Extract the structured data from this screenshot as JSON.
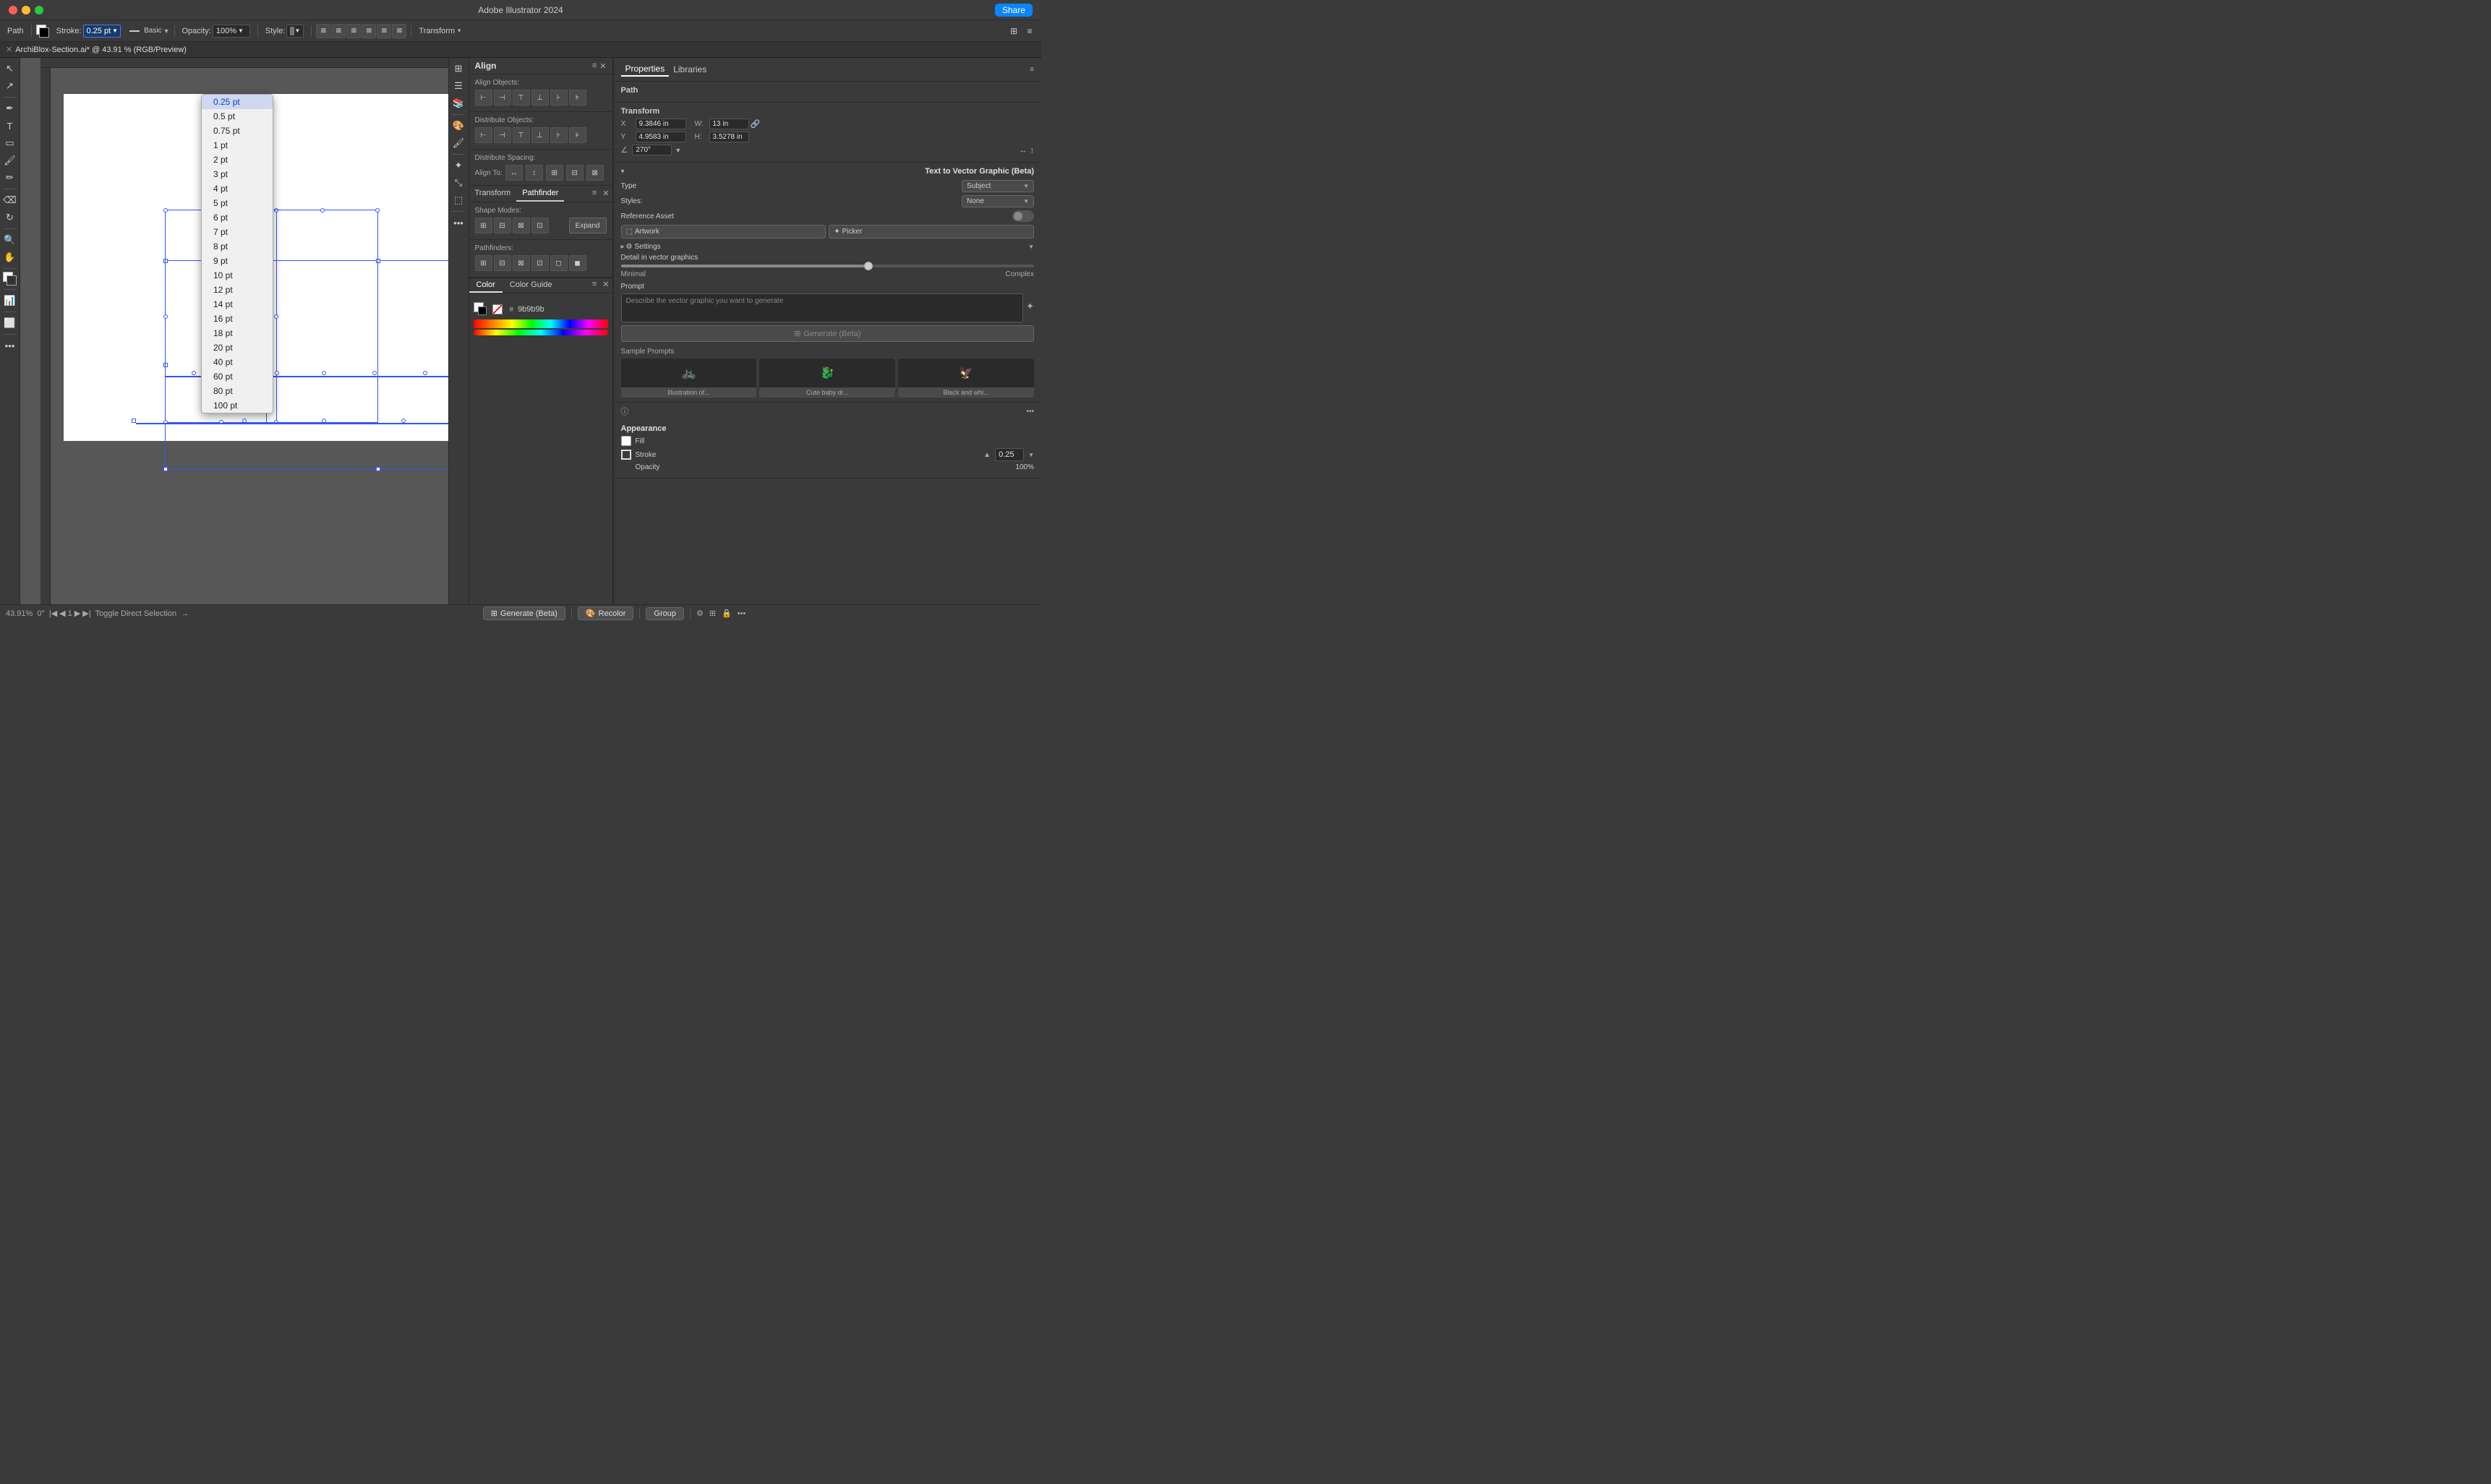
{
  "app": {
    "title": "Adobe Illustrator 2024",
    "share_label": "Share",
    "tab_label": "ArchiBlox-Section.ai* @ 43.91 % (RGB/Preview)"
  },
  "toolbar": {
    "type_label": "Path",
    "stroke_label": "Stroke:",
    "stroke_value": "0.25 pt",
    "opacity_label": "Opacity:",
    "opacity_value": "100%",
    "style_label": "Style:",
    "basic_label": "Basic",
    "transform_label": "Transform"
  },
  "stroke_dropdown": {
    "items": [
      {
        "value": "0.25 pt",
        "selected": true
      },
      {
        "value": "0.5 pt",
        "selected": false
      },
      {
        "value": "0.75 pt",
        "selected": false
      },
      {
        "value": "1 pt",
        "selected": false
      },
      {
        "value": "2 pt",
        "selected": false
      },
      {
        "value": "3 pt",
        "selected": false
      },
      {
        "value": "4 pt",
        "selected": false
      },
      {
        "value": "5 pt",
        "selected": false
      },
      {
        "value": "6 pt",
        "selected": false
      },
      {
        "value": "7 pt",
        "selected": false
      },
      {
        "value": "8 pt",
        "selected": false
      },
      {
        "value": "9 pt",
        "selected": false
      },
      {
        "value": "10 pt",
        "selected": false
      },
      {
        "value": "12 pt",
        "selected": false
      },
      {
        "value": "14 pt",
        "selected": false
      },
      {
        "value": "16 pt",
        "selected": false
      },
      {
        "value": "18 pt",
        "selected": false
      },
      {
        "value": "20 pt",
        "selected": false
      },
      {
        "value": "40 pt",
        "selected": false
      },
      {
        "value": "60 pt",
        "selected": false
      },
      {
        "value": "80 pt",
        "selected": false
      },
      {
        "value": "100 pt",
        "selected": false
      }
    ]
  },
  "align_panel": {
    "title": "Align",
    "align_objects_label": "Align Objects:",
    "distribute_objects_label": "Distribute Objects:",
    "distribute_spacing_label": "Distribute Spacing:",
    "align_to_label": "Align To:"
  },
  "pathfinder_panel": {
    "shape_modes_label": "Shape Modes:",
    "pathfinders_label": "Pathfinders:",
    "expand_label": "Expand"
  },
  "color_panel": {
    "color_tab": "Color",
    "color_guide_tab": "Color Guide",
    "hex_value": "9b9b9b"
  },
  "properties_panel": {
    "properties_tab": "Properties",
    "libraries_tab": "Libraries",
    "path_label": "Path",
    "transform_label": "Transform",
    "x_label": "X",
    "x_value": "9.3846 in",
    "y_label": "Y",
    "y_value": "4.9583 in",
    "w_label": "W:",
    "w_value": "13 in",
    "h_label": "H:",
    "h_value": "3.5278 in",
    "angle_label": "270°",
    "text_to_vector_title": "Text to Vector Graphic (Beta)",
    "type_label": "Type",
    "type_value": "Subject",
    "styles_label": "Styles:",
    "styles_value": "None",
    "reference_asset_label": "Reference Asset",
    "artwork_label": "Artwork",
    "picker_label": "Picker",
    "settings_label": "Settings",
    "detail_label": "Detail in vector graphics",
    "minimal_label": "Minimal",
    "complex_label": "Complex",
    "prompt_label": "Prompt",
    "prompt_placeholder": "Describe the vector graphic you want to generate",
    "generate_label": "Generate (Beta)",
    "sample_prompts_label": "Sample Prompts",
    "sample_1_label": "Illustration of...",
    "sample_2_label": "Cute baby dr...",
    "sample_3_label": "Black and whi...",
    "appearance_label": "Appearance",
    "fill_label": "Fill",
    "stroke_prop_label": "Stroke",
    "stroke_prop_value": "0.25",
    "opacity_prop_label": "Opacity",
    "opacity_prop_value": "100%"
  },
  "bottom_bar": {
    "zoom_value": "43.91%",
    "angle_value": "0°",
    "page_value": "1",
    "toggle_label": "Toggle Direct Selection",
    "generate_label": "Generate (Beta)",
    "recolor_label": "Recolor",
    "group_label": "Group"
  },
  "icons": {
    "expand": "▸",
    "collapse": "▾",
    "more": "•••",
    "close": "✕",
    "arrow_left": "◀",
    "arrow_right": "▶",
    "arrow_up": "▲",
    "arrow_down": "▼",
    "lock": "🔒",
    "settings_gear": "⚙",
    "sparkle": "✦",
    "dice": "⚂",
    "link": "🔗"
  }
}
